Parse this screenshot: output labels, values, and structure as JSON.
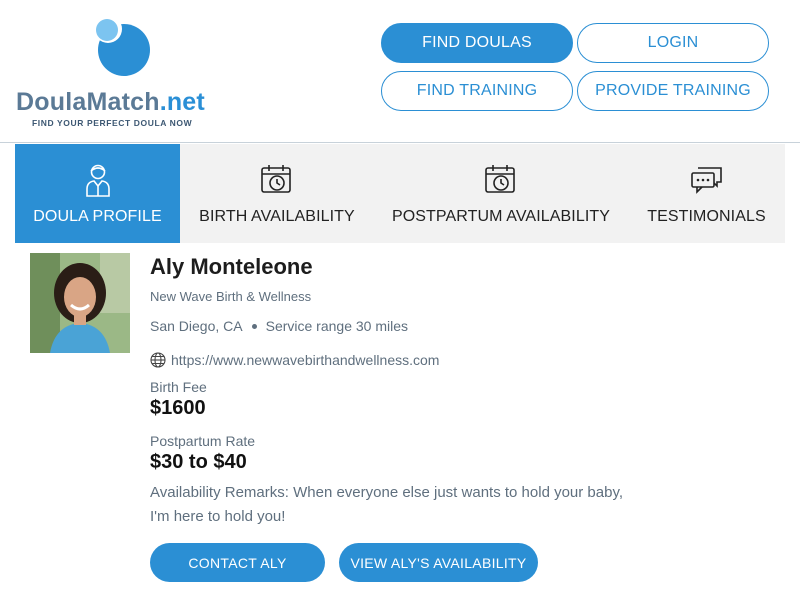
{
  "brand": {
    "name_part1": "Doula",
    "name_part2": "Match",
    "name_part3": ".net",
    "tagline": "FIND YOUR PERFECT DOULA NOW",
    "logo_icon": "droplet-logo-icon"
  },
  "nav": {
    "find_doulas": "FIND DOULAS",
    "login": "LOGIN",
    "find_training": "FIND TRAINING",
    "provide_training": "PROVIDE TRAINING"
  },
  "tabs": [
    {
      "label": "DOULA PROFILE",
      "icon": "person-icon",
      "active": true
    },
    {
      "label": "BIRTH AVAILABILITY",
      "icon": "calendar-clock-icon",
      "active": false
    },
    {
      "label": "POSTPARTUM AVAILABILITY",
      "icon": "calendar-clock-icon",
      "active": false
    },
    {
      "label": "TESTIMONIALS",
      "icon": "chat-bubbles-icon",
      "active": false
    }
  ],
  "profile": {
    "name": "Aly Monteleone",
    "company": "New Wave Birth & Wellness",
    "city": "San Diego, CA",
    "service_range": "Service range 30 miles",
    "website": "https://www.newwavebirthandwellness.com",
    "birth_fee_label": "Birth Fee",
    "birth_fee": "$1600",
    "postpartum_rate_label": "Postpartum Rate",
    "postpartum_rate": "$30 to $40",
    "remarks": "Availability Remarks: When everyone else just wants to hold your baby, I'm here to hold you!"
  },
  "actions": {
    "contact": "CONTACT ALY",
    "view_availability": "VIEW ALY'S AVAILABILITY"
  },
  "colors": {
    "accent": "#2b8fd4",
    "tab_bg": "#f2f2f2",
    "muted_text": "#5f6f7e"
  }
}
